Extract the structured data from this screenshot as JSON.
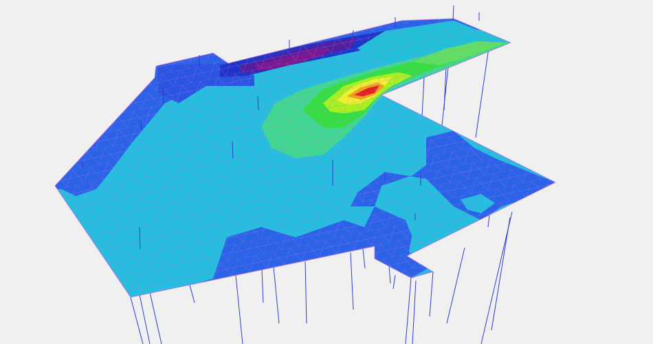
{
  "view": {
    "type": "3d-slab-contour-plot",
    "background_color": "#f0f0f0",
    "mesh_line_color": "#c070e0",
    "column_line_color": "#2b3ad6",
    "projection": "perspective",
    "legend_visible": false,
    "axes_visible": false
  },
  "palette": {
    "darkest_blue": "#1a1aa0",
    "deep_blue": "#2a3fd0",
    "blue": "#1f6ff0",
    "light_blue": "#23b8d8",
    "cyan": "#25c8e0",
    "teal": "#20d8b8",
    "green_light": "#40e080",
    "green": "#30e030",
    "yellow_green": "#a0f020",
    "yellow": "#f0f030",
    "orange": "#f0a020",
    "red": "#e02020",
    "dark_red": "#a01060",
    "purple": "#6a20a0",
    "dark_purple": "#40208a"
  }
}
